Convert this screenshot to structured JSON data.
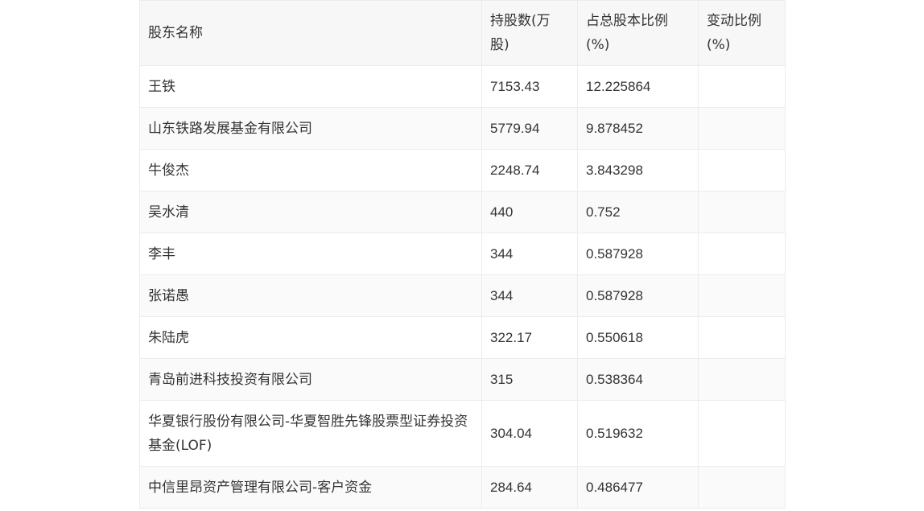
{
  "headers": [
    "股东名称",
    "持股数(万股)",
    "占总股本比例(%)",
    "变动比例(%)"
  ],
  "rows": [
    {
      "name": "王铁",
      "shares": "7153.43",
      "ratio": "12.225864",
      "change": ""
    },
    {
      "name": "山东铁路发展基金有限公司",
      "shares": "5779.94",
      "ratio": "9.878452",
      "change": ""
    },
    {
      "name": "牛俊杰",
      "shares": "2248.74",
      "ratio": "3.843298",
      "change": ""
    },
    {
      "name": "吴水清",
      "shares": "440",
      "ratio": "0.752",
      "change": ""
    },
    {
      "name": "李丰",
      "shares": "344",
      "ratio": "0.587928",
      "change": ""
    },
    {
      "name": "张诺愚",
      "shares": "344",
      "ratio": "0.587928",
      "change": ""
    },
    {
      "name": "朱陆虎",
      "shares": "322.17",
      "ratio": "0.550618",
      "change": ""
    },
    {
      "name": "青岛前进科技投资有限公司",
      "shares": "315",
      "ratio": "0.538364",
      "change": ""
    },
    {
      "name": "华夏银行股份有限公司-华夏智胜先锋股票型证券投资基金(LOF)",
      "shares": "304.04",
      "ratio": "0.519632",
      "change": ""
    },
    {
      "name": "中信里昂资产管理有限公司-客户资金",
      "shares": "284.64",
      "ratio": "0.486477",
      "change": ""
    }
  ]
}
